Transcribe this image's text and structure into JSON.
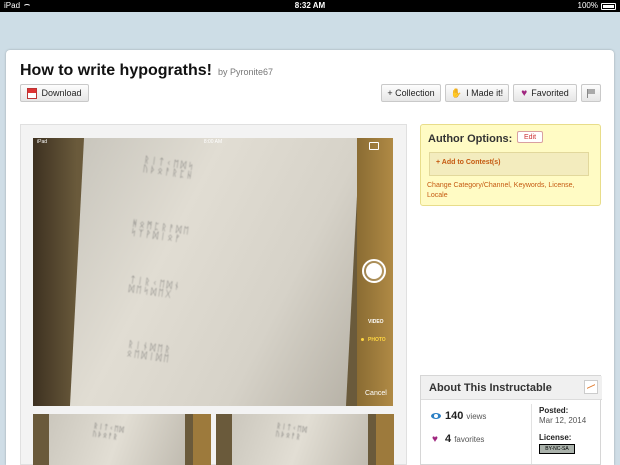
{
  "status_bar": {
    "device": "iPad",
    "time": "8:32 AM",
    "battery": "100%"
  },
  "header": {
    "title": "How to write hypograths!",
    "by": "by Pyronite67",
    "download_label": "Download",
    "collection_label": "+ Collection",
    "made_it_label": "I Made it!",
    "favorited_label": "Favorited"
  },
  "photo": {
    "ios_carrier": "iPad",
    "ios_time": "8:00 AM",
    "video_label": "VIDEO",
    "photo_label": "PHOTO",
    "cancel_label": "Cancel"
  },
  "author_options": {
    "title": "Author Options:",
    "edit_label": "Edit",
    "contest_link": "+ Add to Contest(s)",
    "links": "Change Category/Channel, Keywords, License, Locale"
  },
  "about": {
    "title": "About This Instructable",
    "views_count": "140",
    "views_label": "views",
    "favorites_count": "4",
    "favorites_label": "favorites",
    "posted_label": "Posted:",
    "posted_date": "Mar 12, 2014",
    "license_label": "License:",
    "license_badge": "BY-NC-SA"
  },
  "colors": {
    "accent": "#c55a11",
    "heart": "#a0267f",
    "author_bg": "#fffbc4"
  }
}
